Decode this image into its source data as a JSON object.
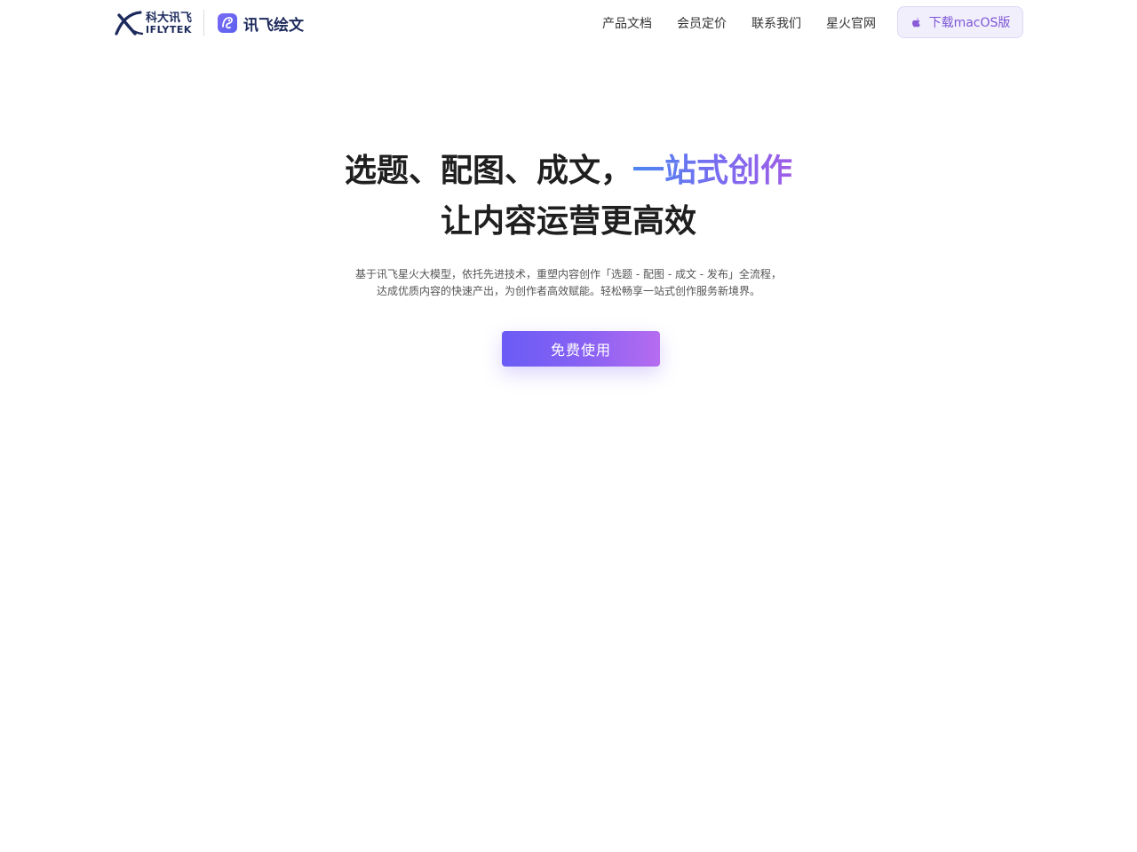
{
  "header": {
    "brand_cn": "科大讯飞",
    "brand_en": "IFLYTEK",
    "app_name": "讯飞绘文",
    "nav": [
      "产品文档",
      "会员定价",
      "联系我们",
      "星火官网"
    ],
    "download_label": "下载macOS版"
  },
  "hero": {
    "title_part1": "选题、配图、成文，",
    "title_highlight": "一站式创作",
    "title_line2": "让内容运营更高效",
    "desc_line1": "基于讯飞星火大模型，依托先进技术，重塑内容创作「选题 - 配图 - 成文 - 发布」全流程，",
    "desc_line2": "达成优质内容的快速产出，为创作者高效赋能。轻松畅享一站式创作服务新境界。",
    "cta_label": "免费使用"
  },
  "colors": {
    "brand_navy": "#1d2a5c",
    "accent_purple": "#7d55d6",
    "gradient_start": "#4d86f0",
    "gradient_end": "#a05de6"
  },
  "icons": [
    "iflytek-logo",
    "app-logo-icon",
    "apple-icon"
  ]
}
